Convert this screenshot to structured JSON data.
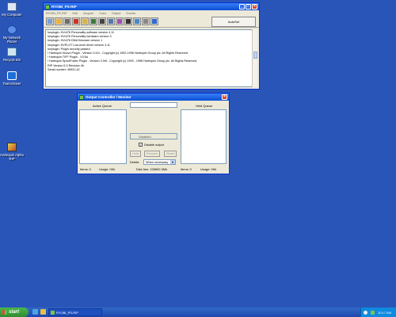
{
  "desktop": {
    "icons": [
      {
        "label": "My Computer"
      },
      {
        "label": "My Network Places"
      },
      {
        "label": "Recycle Bin"
      },
      {
        "label": "TeamViewer"
      },
      {
        "label": "Harlequin Alpha RIP"
      }
    ]
  },
  "rip_window": {
    "title": "RYOBI_PS-RIP",
    "menu": [
      "RYOBI_PS-RIP",
      "Edit",
      "Acquire",
      "Color",
      "Output",
      "Events"
    ],
    "autoset_label": "AutoSet",
    "log_lines": [
      "hwplugin: HVr476 Personality software version 4.11",
      "hwplugin: HVr476 Personality hardware version 3",
      "hwplugin: HVr476 DMA firmware version 1",
      "hwplugin: HVPLOT Low-level driver version 4.11",
      "hwplugin: Plugin security passed.",
      "! Harlequin Nuovo Plugin - Version 3.0r4 - Copyright (c) 1992-1998 Harlequin Group plc. All Rights Reserved.",
      "! Harlequin TIFF Plugin - V3.6a",
      "! Harlequin SpoolFolder Plugin - Version 3.0r5 - Copyright (c) 1993 - 1998 Harlequin Group plc. All Rights Reserved.",
      "RIP Version 5.3 Revision 4b",
      "Serial number: 45931-42"
    ]
  },
  "output_controller": {
    "title": "Output Controller / Monitor",
    "active_queue_label": "Active Queue",
    "held_queue_label": "Held Queue",
    "status_field_value": "Disabled",
    "disable_output_label": "Disable output",
    "disable_output_checked": true,
    "buttons": {
      "hold": "Hold",
      "remove": "Remove",
      "reset": "Reset"
    },
    "delete_label": "Delete:",
    "delete_selected": "When necessary",
    "active_items": "Items: 0",
    "active_usage": "Usage: 0Kb",
    "disk_free": "Disk free: 226892.3Mb",
    "held_items": "Items: 0",
    "held_usage": "Usage: 0Kb"
  },
  "taskbar": {
    "start_label": "start",
    "task_label": "RYOBI_PS-RIP",
    "clock": "10:17 AM"
  },
  "colors": {
    "desktop": "#2a55b8",
    "titlebar": "#0a4fd6",
    "window_bg": "#ece9d8",
    "start_button": "#3a9b3a"
  }
}
